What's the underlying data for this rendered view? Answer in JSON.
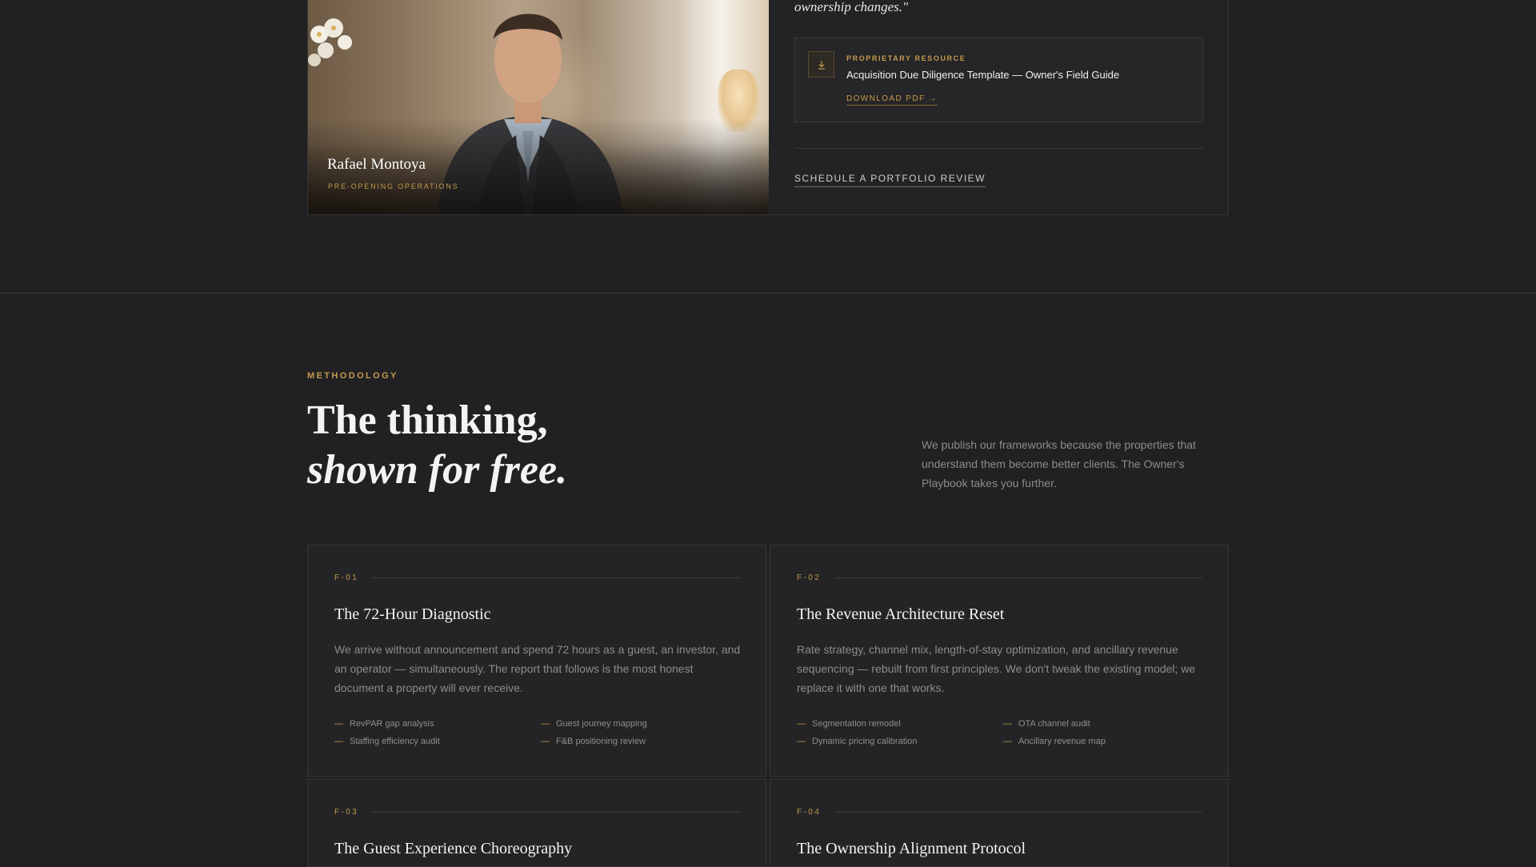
{
  "profile": {
    "name": "Rafael Montoya",
    "role": "PRE-OPENING OPERATIONS",
    "quote_end": "ownership changes.\"",
    "resource": {
      "tag": "PROPRIETARY RESOURCE",
      "title": "Acquisition Due Diligence Template — Owner's Field Guide",
      "link": "DOWNLOAD PDF →"
    },
    "schedule_link": "SCHEDULE A PORTFOLIO REVIEW"
  },
  "methodology": {
    "eyebrow": "METHODOLOGY",
    "headline_line1": "The thinking,",
    "headline_line2": "shown for free.",
    "lead": "We publish our frameworks because the properties that understand them become better clients. The Owner's Playbook takes you further.",
    "frameworks": [
      {
        "code": "F-01",
        "title": "The 72-Hour Diagnostic",
        "description": "We arrive without announcement and spend 72 hours as a guest, an investor, and an operator — simultaneously. The report that follows is the most honest document a property will ever receive.",
        "features": [
          "RevPAR gap analysis",
          "Guest journey mapping",
          "Staffing efficiency audit",
          "F&B positioning review"
        ]
      },
      {
        "code": "F-02",
        "title": "The Revenue Architecture Reset",
        "description": "Rate strategy, channel mix, length-of-stay optimization, and ancillary revenue sequencing — rebuilt from first principles. We don't tweak the existing model; we replace it with one that works.",
        "features": [
          "Segmentation remodel",
          "OTA channel audit",
          "Dynamic pricing calibration",
          "Ancillary revenue map"
        ]
      },
      {
        "code": "F-03",
        "title": "The Guest Experience Choreography"
      },
      {
        "code": "F-04",
        "title": "The Ownership Alignment Protocol"
      }
    ]
  },
  "colors": {
    "background": "#212123",
    "accent_gold": "#c59a4e",
    "card": "#242426"
  },
  "icons": {
    "download": "download-icon"
  }
}
